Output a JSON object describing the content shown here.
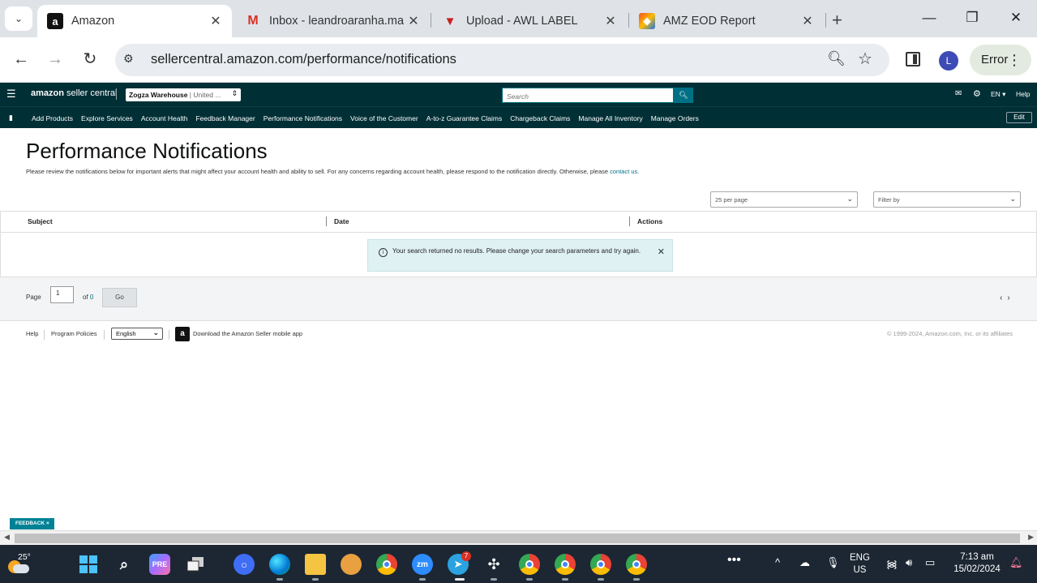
{
  "browser": {
    "tabs": [
      {
        "title": "Amazon",
        "favicon": "amazon-a",
        "active": true
      },
      {
        "title": "Inbox - leandroaranha.ma",
        "favicon": "gmail-m",
        "active": false
      },
      {
        "title": "Upload - AWL LABEL",
        "favicon": "awl-shield",
        "active": false
      },
      {
        "title": "AMZ EOD Report",
        "favicon": "colorful-stack",
        "active": false
      }
    ],
    "url": "sellercentral.amazon.com/performance/notifications",
    "profile_initial": "L",
    "error_label": "Error"
  },
  "sc_header": {
    "logo_brand": "amazon",
    "logo_suffix": "seller central",
    "store_name": "Zogza Warehouse",
    "store_region": "| United ...",
    "search_placeholder": "Search",
    "lang": "EN",
    "help": "Help"
  },
  "sc_nav": {
    "links": [
      "Add Products",
      "Explore Services",
      "Account Health",
      "Feedback Manager",
      "Performance Notifications",
      "Voice of the Customer",
      "A-to-z Guarantee Claims",
      "Chargeback Claims",
      "Manage All Inventory",
      "Manage Orders"
    ],
    "edit_label": "Edit"
  },
  "page": {
    "title": "Performance Notifications",
    "description": "Please review the notifications below for important alerts that might affect your account health and ability to sell. For any concerns regarding account health, please respond to the notification directly. Otherwise, please ",
    "contact_link": "contact us.",
    "per_page": "25 per page",
    "filter_by": "Filter by"
  },
  "table": {
    "headers": [
      "Subject",
      "Date",
      "Actions"
    ],
    "empty_message": "Your search returned no results. Please change your search parameters and try again."
  },
  "pager": {
    "page_label": "Page",
    "page_value": "1",
    "of_label": "of",
    "total_pages": "0",
    "go_label": "Go"
  },
  "footer": {
    "help": "Help",
    "policies": "Program Policies",
    "language": "English",
    "app_text": "Download the Amazon Seller mobile app",
    "copyright": "© 1999-2024, Amazon.com, Inc. or its affiliates"
  },
  "feedback": {
    "label": "FEEDBACK",
    "close": "×"
  },
  "taskbar": {
    "temperature": "25°",
    "telegram_badge": "7",
    "lang_line1": "ENG",
    "lang_line2": "US",
    "time": "7:13 am",
    "date": "15/02/2024"
  }
}
